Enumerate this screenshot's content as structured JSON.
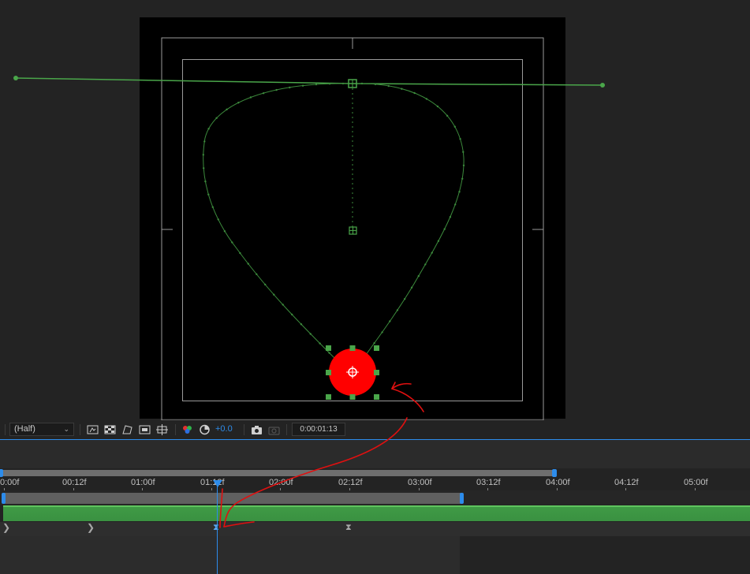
{
  "viewer": {
    "resolution": "(Half)",
    "exposure": "+0.0",
    "current_time": "0:00:01:13",
    "icons": [
      "preview-toggle-icon",
      "transparency-grid-icon",
      "mask-visibility-icon",
      "region-of-interest-icon",
      "guides-icon",
      "channel-rgb-icon",
      "reset-exposure-icon",
      "snapshot-icon",
      "show-snapshot-icon"
    ]
  },
  "composition": {
    "layer_color": "#ff0000",
    "path_color": "#3c8a3c",
    "handle_color": "#4aa64a",
    "frame_color": "#9a9a9a"
  },
  "timeline": {
    "ticks": [
      "0:00f",
      "00:12f",
      "01:00f",
      "01:12f",
      "02:00f",
      "02:12f",
      "03:00f",
      "03:12f",
      "04:00f",
      "04:12f",
      "05:00f"
    ],
    "accent_color": "#2d8ceb",
    "track_color": "#3f9a45"
  },
  "annotation": {
    "color": "#e01010"
  }
}
